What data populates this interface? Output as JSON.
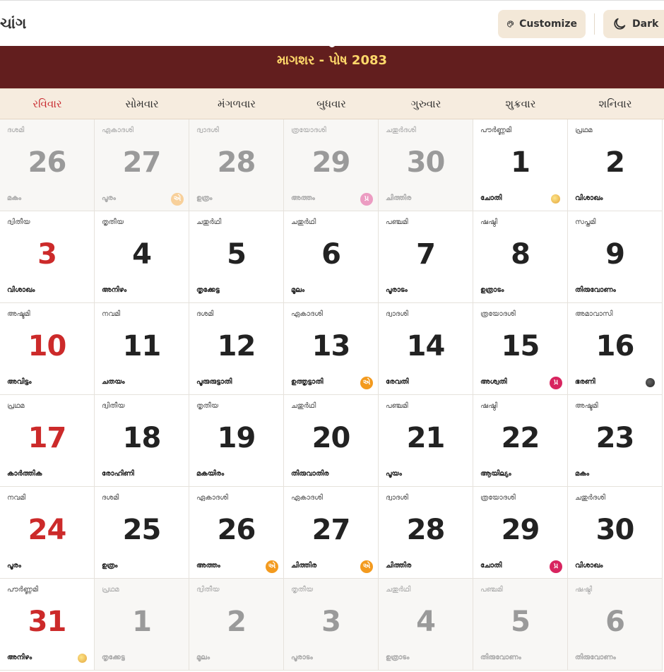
{
  "header": {
    "app_title": "ચાંગ",
    "customize_label": "Customize",
    "dark_label": "Dark",
    "month_title": "માગશર - પોષ 2083"
  },
  "weekdays": [
    "રવિવાર",
    "સોમવાર",
    "મંગળવાર",
    "બુધવાર",
    "ગુરુવાર",
    "શુક્રવાર",
    "શનિવાર"
  ],
  "colors": {
    "header_bg": "#621e1e",
    "header_text": "#ffd86a",
    "sunday": "#cc2a2a",
    "muted": "#9a9a9a",
    "ekadashi_badge": "#f39a1e",
    "pradosh_badge": "#d8245f"
  },
  "badges": {
    "ekadashi": "એ",
    "pradosh": "પ્ર"
  },
  "weeks": [
    [
      {
        "day": "26",
        "tithi": "ദശമി",
        "nakshatra": "മകം",
        "other": true
      },
      {
        "day": "27",
        "tithi": "ഏകാദശി",
        "nakshatra": "പൂരം",
        "other": true,
        "badge": "ekadashi"
      },
      {
        "day": "28",
        "tithi": "ദ്വാദശി",
        "nakshatra": "ഉത്രം",
        "other": true
      },
      {
        "day": "29",
        "tithi": "ത്രയോദശി",
        "nakshatra": "അത്തം",
        "other": true,
        "badge": "pradosh"
      },
      {
        "day": "30",
        "tithi": "ചതുർദശി",
        "nakshatra": "ചിത്തിര",
        "other": true
      },
      {
        "day": "1",
        "tithi": "പൗർണ്ണമി",
        "nakshatra": "ചോതി",
        "moon": "full"
      },
      {
        "day": "2",
        "tithi": "പ്രഥമ",
        "nakshatra": "വിശാഖം"
      }
    ],
    [
      {
        "day": "3",
        "tithi": "ദ്വിതീയ",
        "nakshatra": "വിശാഖം"
      },
      {
        "day": "4",
        "tithi": "തൃതീയ",
        "nakshatra": "അനിഴം"
      },
      {
        "day": "5",
        "tithi": "ചതുർഥി",
        "nakshatra": "തൃക്കേട്ട"
      },
      {
        "day": "6",
        "tithi": "ചതുർഥി",
        "nakshatra": "മൂലം"
      },
      {
        "day": "7",
        "tithi": "പഞ്ചമി",
        "nakshatra": "പൂരാടം"
      },
      {
        "day": "8",
        "tithi": "ഷഷ്ഠി",
        "nakshatra": "ഉത്രാടം"
      },
      {
        "day": "9",
        "tithi": "സപ്തമി",
        "nakshatra": "തിരുവോണം"
      }
    ],
    [
      {
        "day": "10",
        "tithi": "അഷ്ടമി",
        "nakshatra": "അവിട്ടം"
      },
      {
        "day": "11",
        "tithi": "നവമി",
        "nakshatra": "ചതയം"
      },
      {
        "day": "12",
        "tithi": "ദശമി",
        "nakshatra": "പൂരുരുട്ടാതി"
      },
      {
        "day": "13",
        "tithi": "ഏകാദശി",
        "nakshatra": "ഉത്തൃട്ടാതി",
        "badge": "ekadashi"
      },
      {
        "day": "14",
        "tithi": "ദ്വാദശി",
        "nakshatra": "രേവതി"
      },
      {
        "day": "15",
        "tithi": "ത്രയോദശി",
        "nakshatra": "അശ്വതി",
        "badge": "pradosh"
      },
      {
        "day": "16",
        "tithi": "അമാവാസി",
        "nakshatra": "ഭരണി",
        "moon": "new"
      }
    ],
    [
      {
        "day": "17",
        "tithi": "പ്രഥമ",
        "nakshatra": "കാർത്തിക"
      },
      {
        "day": "18",
        "tithi": "ദ്വിതീയ",
        "nakshatra": "രോഹിണി"
      },
      {
        "day": "19",
        "tithi": "തൃതീയ",
        "nakshatra": "മകയിരം"
      },
      {
        "day": "20",
        "tithi": "ചതുർഥി",
        "nakshatra": "തിരുവാതിര"
      },
      {
        "day": "21",
        "tithi": "പഞ്ചമി",
        "nakshatra": "പൂയം"
      },
      {
        "day": "22",
        "tithi": "ഷഷ്ഠി",
        "nakshatra": "ആയില്യം"
      },
      {
        "day": "23",
        "tithi": "അഷ്ടമി",
        "nakshatra": "മകം"
      }
    ],
    [
      {
        "day": "24",
        "tithi": "നവമി",
        "nakshatra": "പൂരം"
      },
      {
        "day": "25",
        "tithi": "ദശമി",
        "nakshatra": "ഉത്രം"
      },
      {
        "day": "26",
        "tithi": "ഏകാദശി",
        "nakshatra": "അത്തം",
        "badge": "ekadashi"
      },
      {
        "day": "27",
        "tithi": "ഏകാദശി",
        "nakshatra": "ചിത്തിര",
        "badge": "ekadashi"
      },
      {
        "day": "28",
        "tithi": "ദ്വാദശി",
        "nakshatra": "ചിത്തിര"
      },
      {
        "day": "29",
        "tithi": "ത്രയോദശി",
        "nakshatra": "ചോതി",
        "badge": "pradosh"
      },
      {
        "day": "30",
        "tithi": "ചതുർദശി",
        "nakshatra": "വിശാഖം"
      }
    ],
    [
      {
        "day": "31",
        "tithi": "പൗർണ്ണമി",
        "nakshatra": "അനിഴം",
        "moon": "full"
      },
      {
        "day": "1",
        "tithi": "പ്രഥമ",
        "nakshatra": "തൃക്കേട്ട",
        "other": true
      },
      {
        "day": "2",
        "tithi": "ദ്വിതീയ",
        "nakshatra": "മൂലം",
        "other": true
      },
      {
        "day": "3",
        "tithi": "തൃതീയ",
        "nakshatra": "പൂരാടം",
        "other": true
      },
      {
        "day": "4",
        "tithi": "ചതുർഥി",
        "nakshatra": "ഉത്രാടം",
        "other": true
      },
      {
        "day": "5",
        "tithi": "പഞ്ചമി",
        "nakshatra": "തിരുവോണം",
        "other": true
      },
      {
        "day": "6",
        "tithi": "ഷഷ്ഠി",
        "nakshatra": "തിരുവോണം",
        "other": true
      }
    ]
  ]
}
